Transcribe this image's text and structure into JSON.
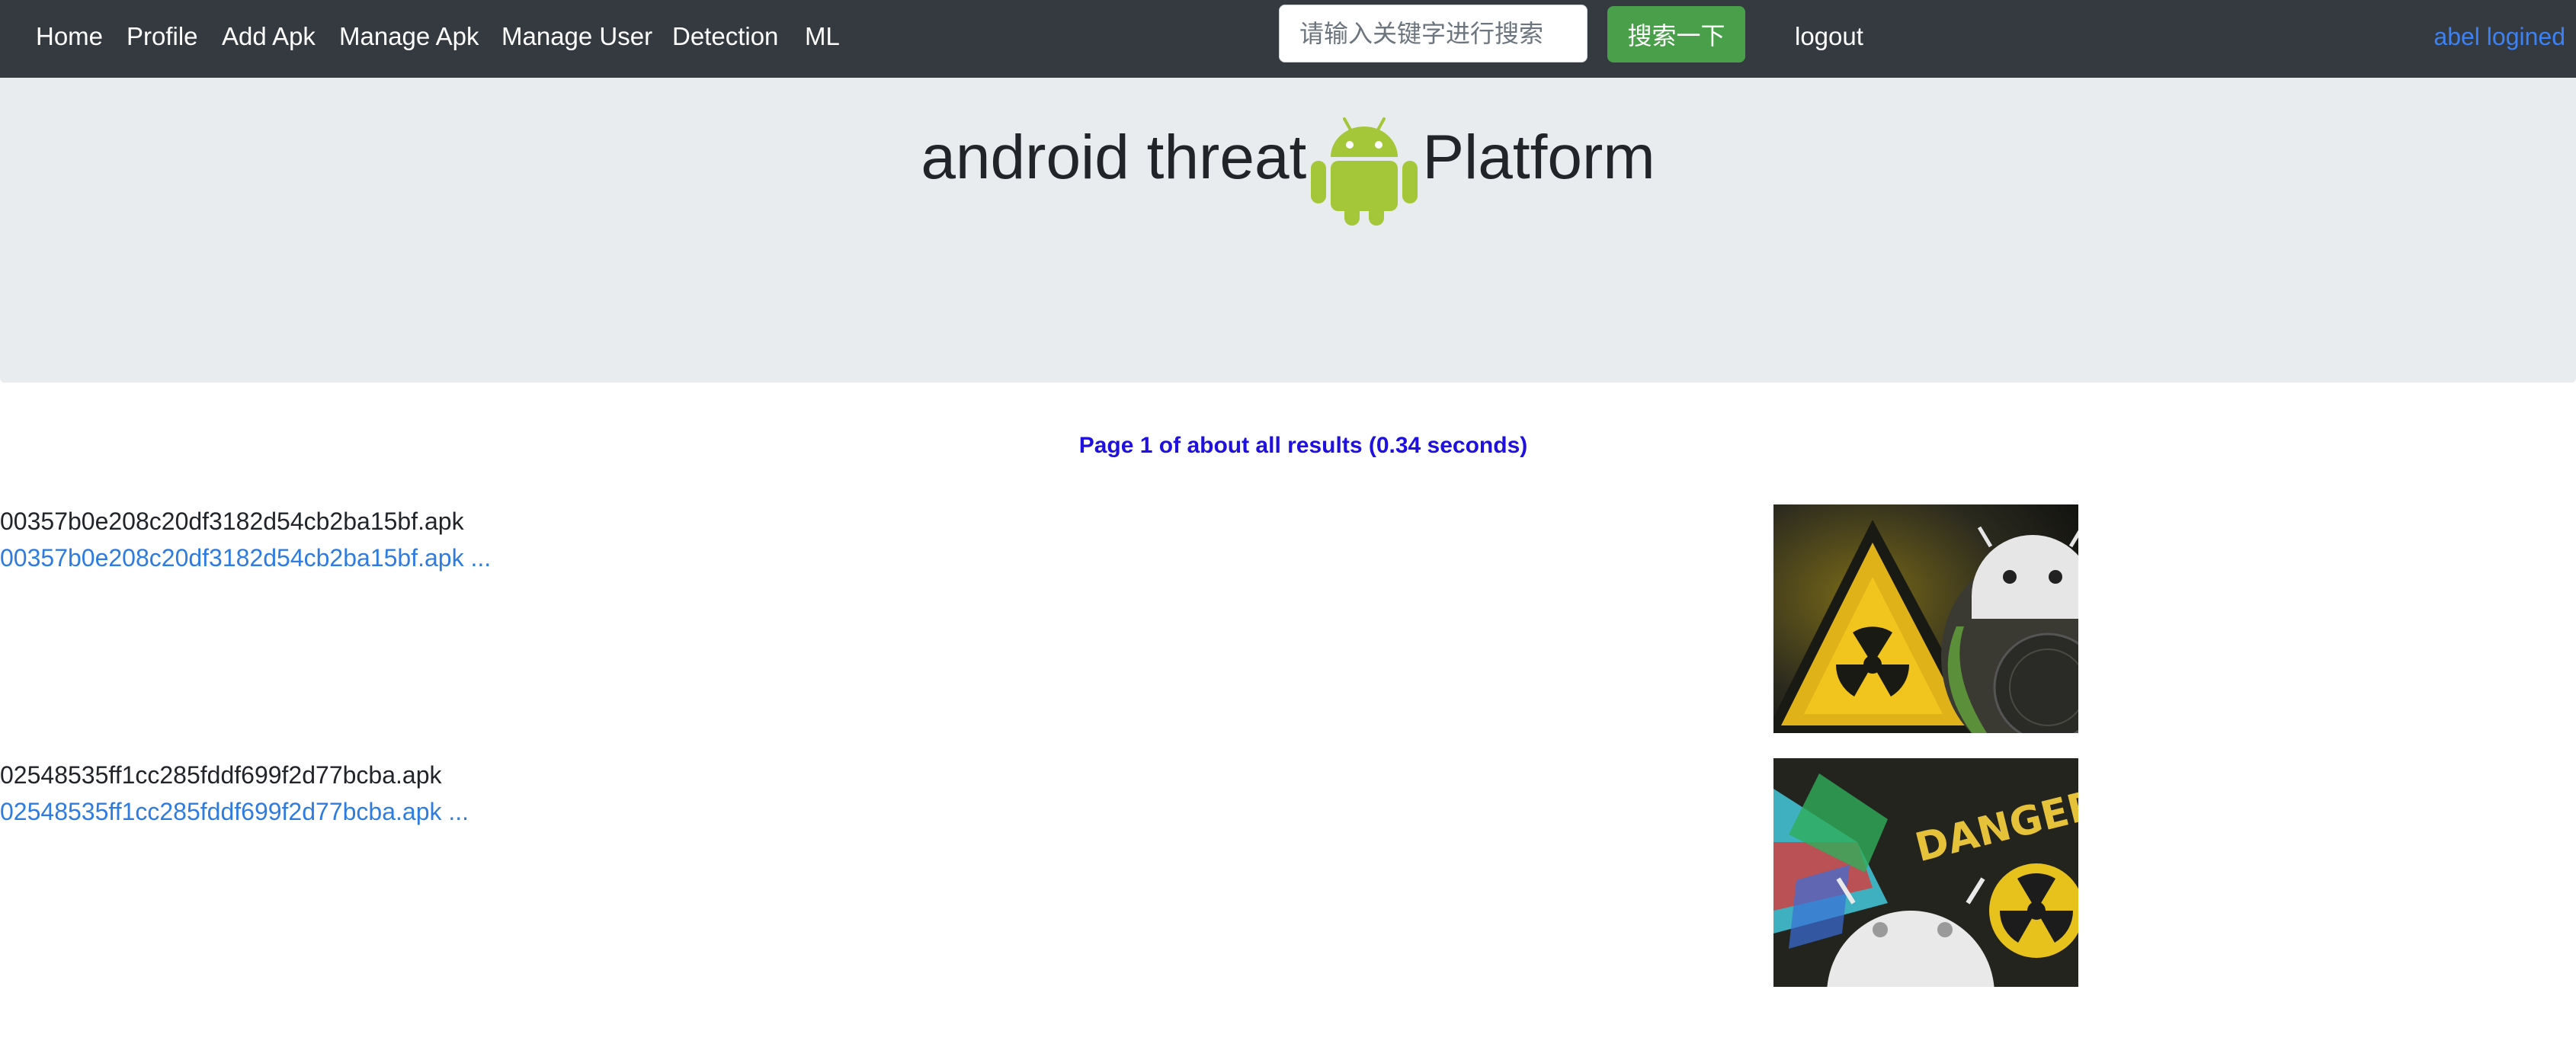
{
  "nav": {
    "items": [
      {
        "label": "Home"
      },
      {
        "label": "Profile"
      },
      {
        "label": "Add Apk"
      },
      {
        "label": "Manage Apk"
      },
      {
        "label": "Manage User"
      },
      {
        "label": "Detection"
      },
      {
        "label": "ML"
      }
    ],
    "search_placeholder": "请输入关键字进行搜索",
    "search_button": "搜索一下",
    "logout": "logout",
    "user_status": "abel logined"
  },
  "hero": {
    "title_left": "android threat",
    "title_right": "Platform",
    "logo_icon": "android-robot-icon",
    "logo_color": "#a4c639"
  },
  "results_info": "Page 1 of about all results (0.34 seconds)",
  "results": [
    {
      "title": "00357b0e208c20df3182d54cb2ba15bf.apk",
      "link": "00357b0e208c20df3182d54cb2ba15bf.apk ..."
    },
    {
      "title": "02548535ff1cc285fddf699f2d77bcba.apk",
      "link": "02548535ff1cc285fddf699f2d77bcba.apk ..."
    }
  ],
  "thumbnails": [
    {
      "label": "DANGER"
    }
  ],
  "colors": {
    "navbar": "#343a40",
    "hero": "#e9ecef",
    "accent_link": "#2f7ce0",
    "search_button": "#4aa04a",
    "page_info": "#1f10e0"
  }
}
